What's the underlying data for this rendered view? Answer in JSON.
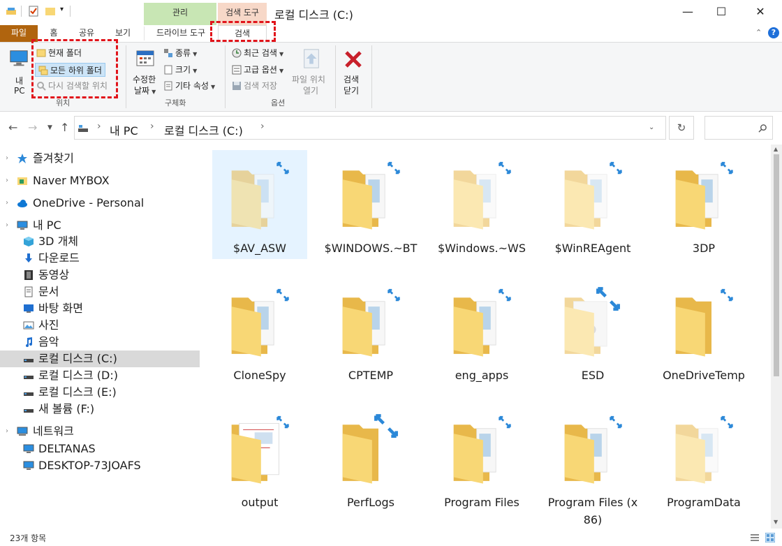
{
  "window": {
    "title": "로컬 디스크 (C:)",
    "context_group": "관리",
    "context_search_tool": "검색 도구",
    "minimize": "—",
    "maximize": "☐",
    "close": "✕"
  },
  "ribbon_tabs": {
    "file": "파일",
    "home": "홈",
    "share": "공유",
    "view": "보기",
    "drive_tools": "드라이브 도구",
    "search": "검색"
  },
  "ribbon": {
    "my_pc_line1": "내",
    "my_pc_line2": "PC",
    "current_folder": "현재 폴더",
    "all_subfolders": "모든 하위 폴더",
    "search_again_in": "다시 검색할 위치",
    "location_group": "위치",
    "date_modified_line1": "수정한",
    "date_modified_line2": "날짜",
    "kind": "종류",
    "size": "크기",
    "other_properties": "기타 속성",
    "refine_group": "구체화",
    "recent_searches": "최근 검색",
    "advanced_options": "고급 옵션",
    "save_search": "검색 저장",
    "open_file_location_line1": "파일 위치",
    "open_file_location_line2": "열기",
    "options_group": "옵션",
    "close_search_line1": "검색",
    "close_search_line2": "닫기"
  },
  "address": {
    "crumb1": "내 PC",
    "crumb2": "로컬 디스크 (C:)"
  },
  "nav": [
    {
      "label": "즐겨찾기",
      "icon": "star-icon"
    },
    {
      "label": "Naver MYBOX",
      "icon": "mybox-icon"
    },
    {
      "label": "OneDrive - Personal",
      "icon": "cloud-icon"
    },
    {
      "label": "내 PC",
      "icon": "computer-icon"
    },
    {
      "label": "3D 개체",
      "icon": "cube-icon"
    },
    {
      "label": "다운로드",
      "icon": "download-icon"
    },
    {
      "label": "동영상",
      "icon": "film-icon"
    },
    {
      "label": "문서",
      "icon": "document-icon"
    },
    {
      "label": "바탕 화면",
      "icon": "desktop-icon"
    },
    {
      "label": "사진",
      "icon": "picture-icon"
    },
    {
      "label": "음악",
      "icon": "music-icon"
    },
    {
      "label": "로컬 디스크 (C:)",
      "icon": "drive-icon"
    },
    {
      "label": "로컬 디스크 (D:)",
      "icon": "drive-icon"
    },
    {
      "label": "로컬 디스크 (E:)",
      "icon": "drive-icon"
    },
    {
      "label": "새 볼륨 (F:)",
      "icon": "drive-icon"
    },
    {
      "label": "네트워크",
      "icon": "network-icon"
    },
    {
      "label": "DELTANAS",
      "icon": "computer-icon"
    },
    {
      "label": "DESKTOP-73JOAFS",
      "icon": "computer-icon"
    }
  ],
  "items": [
    {
      "name": "$AV_ASW"
    },
    {
      "name": "$WINDOWS.~BT"
    },
    {
      "name": "$Windows.~WS"
    },
    {
      "name": "$WinREAgent"
    },
    {
      "name": "3DP"
    },
    {
      "name": "CloneSpy"
    },
    {
      "name": "CPTEMP"
    },
    {
      "name": "eng_apps"
    },
    {
      "name": "ESD"
    },
    {
      "name": "OneDriveTemp"
    },
    {
      "name": "output"
    },
    {
      "name": "PerfLogs"
    },
    {
      "name": "Program Files"
    },
    {
      "name": "Program Files (x86)"
    },
    {
      "name": "ProgramData"
    }
  ],
  "status": {
    "count": "23개 항목"
  },
  "colors": {
    "file_tab": "#b0640e",
    "context_green": "#c8e6b4",
    "context_orange": "#f7d8c8",
    "highlight_red": "#e1141b",
    "folder_yellow": "#f8d775",
    "selection": "#e5f3ff"
  }
}
